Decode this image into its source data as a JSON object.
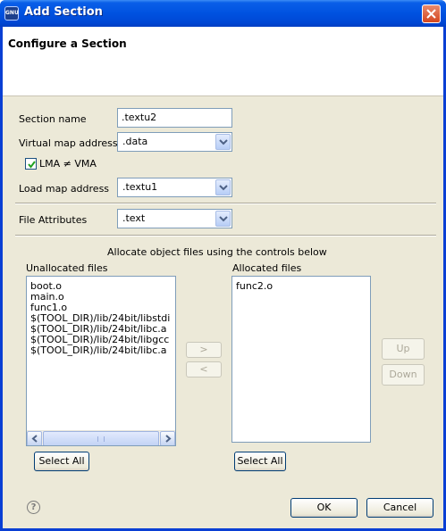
{
  "window": {
    "title": "Add Section",
    "icon_text": "GNU"
  },
  "header": {
    "title": "Configure a Section"
  },
  "form": {
    "section_name_label": "Section name",
    "section_name_value": ".textu2",
    "virtual_map_label": "Virtual map address",
    "virtual_map_value": ".data",
    "lma_checkbox_label": "LMA ≠ VMA",
    "lma_checked": true,
    "load_map_label": "Load map address",
    "load_map_value": ".textu1",
    "file_attr_label": "File Attributes",
    "file_attr_value": ".text"
  },
  "allocation": {
    "instructions": "Allocate object files using the controls below",
    "unallocated_label": "Unallocated files",
    "unallocated_files": [
      "boot.o",
      "main.o",
      "func1.o",
      "$(TOOL_DIR)/lib/24bit/libstdi",
      "$(TOOL_DIR)/lib/24bit/libc.a",
      "$(TOOL_DIR)/lib/24bit/libgcc",
      "$(TOOL_DIR)/lib/24bit/libc.a"
    ],
    "allocated_label": "Allocated files",
    "allocated_files": [
      "func2.o"
    ],
    "move_right_label": ">",
    "move_left_label": "<",
    "up_label": "Up",
    "down_label": "Down",
    "select_all_label": "Select All",
    "scroll_left_glyph": "◀",
    "scroll_right_glyph": "▶"
  },
  "footer": {
    "help_glyph": "?",
    "ok_label": "OK",
    "cancel_label": "Cancel"
  },
  "colors": {
    "titlebar": "#0052e0",
    "dialog_bg": "#ece9d8",
    "button_border": "#003c74"
  },
  "icons": [
    "gnu-app-icon",
    "close-icon",
    "chevron-down-icon",
    "check-icon",
    "help-icon"
  ]
}
